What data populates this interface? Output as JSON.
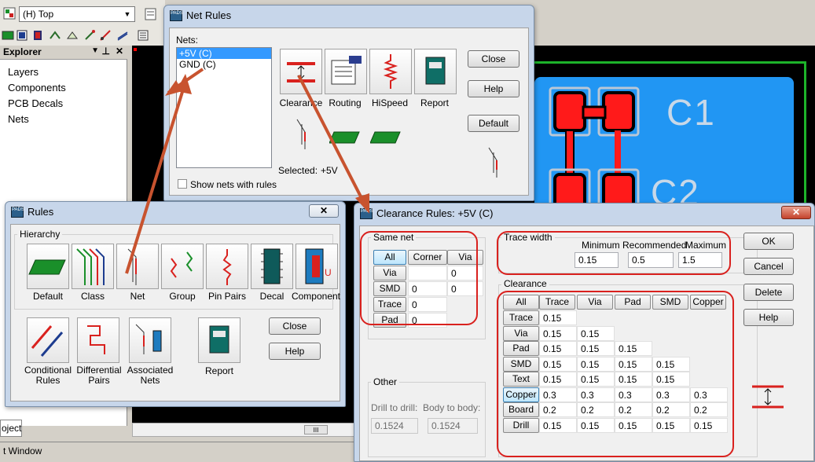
{
  "app": {
    "layer_select": "(H) Top",
    "explorer_title": "Explorer",
    "explorer_items": [
      "Layers",
      "Components",
      "PCB Decals",
      "Nets"
    ],
    "project_tab": "oject",
    "output_window": "t Window",
    "scroll_glyph": "III",
    "pcb_labels": {
      "c1": "C1",
      "c2": "C2"
    }
  },
  "net_rules": {
    "title": "Net Rules",
    "nets_label": "Nets:",
    "nets": [
      "+5V  (C)",
      "GND  (C)"
    ],
    "selected_index": 0,
    "tools": [
      "Clearance",
      "Routing",
      "HiSpeed",
      "Report"
    ],
    "selected_label": "Selected:",
    "selected_value": "+5V",
    "show_nets_label": "Show nets with rules",
    "buttons": {
      "close": "Close",
      "help": "Help",
      "default": "Default"
    }
  },
  "rules": {
    "title": "Rules",
    "close_glyph": "✕",
    "hierarchy_label": "Hierarchy",
    "hierarchy_items": [
      "Default",
      "Class",
      "Net",
      "Group",
      "Pin Pairs",
      "Decal",
      "Component"
    ],
    "other_items": [
      "Conditional\nRules",
      "Differential\nPairs",
      "Associated\nNets",
      "Report"
    ],
    "buttons": {
      "close": "Close",
      "help": "Help"
    }
  },
  "clearance": {
    "title": "Clearance Rules: +5V  (C)",
    "close_glyph": "✕",
    "same_net": {
      "label": "Same net",
      "headers": [
        "All",
        "Corner",
        "Via"
      ],
      "rows": [
        {
          "name": "Via",
          "values": [
            "",
            "0"
          ]
        },
        {
          "name": "SMD",
          "values": [
            "0",
            "0"
          ]
        },
        {
          "name": "Trace",
          "values": [
            "0",
            ""
          ]
        },
        {
          "name": "Pad",
          "values": [
            "0",
            ""
          ]
        }
      ]
    },
    "trace_width": {
      "label": "Trace width",
      "minimum_label": "Minimum",
      "recommended_label": "Recommended",
      "maximum_label": "Maximum",
      "minimum": "0.15",
      "recommended": "0.5",
      "maximum": "1.5"
    },
    "clearance_matrix": {
      "label": "Clearance",
      "headers": [
        "All",
        "Trace",
        "Via",
        "Pad",
        "SMD",
        "Copper"
      ],
      "rows": [
        {
          "name": "Trace",
          "values": [
            "0.15"
          ]
        },
        {
          "name": "Via",
          "values": [
            "0.15",
            "0.15"
          ]
        },
        {
          "name": "Pad",
          "values": [
            "0.15",
            "0.15",
            "0.15"
          ]
        },
        {
          "name": "SMD",
          "values": [
            "0.15",
            "0.15",
            "0.15",
            "0.15"
          ]
        },
        {
          "name": "Text",
          "values": [
            "0.15",
            "0.15",
            "0.15",
            "0.15"
          ]
        },
        {
          "name": "Copper",
          "values": [
            "0.3",
            "0.3",
            "0.3",
            "0.3",
            "0.3"
          ]
        },
        {
          "name": "Board",
          "values": [
            "0.2",
            "0.2",
            "0.2",
            "0.2",
            "0.2"
          ]
        },
        {
          "name": "Drill",
          "values": [
            "0.15",
            "0.15",
            "0.15",
            "0.15",
            "0.15"
          ]
        }
      ]
    },
    "other": {
      "label": "Other",
      "drill_to_drill_label": "Drill to drill:",
      "body_to_body_label": "Body to body:",
      "drill_to_drill": "0.1524",
      "body_to_body": "0.1524"
    },
    "buttons": {
      "ok": "OK",
      "cancel": "Cancel",
      "delete": "Delete",
      "help": "Help"
    }
  },
  "colors": {
    "annotation_red": "#d9211e",
    "board_blue": "#2196f3",
    "board_outline_green": "#1db32a",
    "pad_red": "#ff1a1a"
  }
}
